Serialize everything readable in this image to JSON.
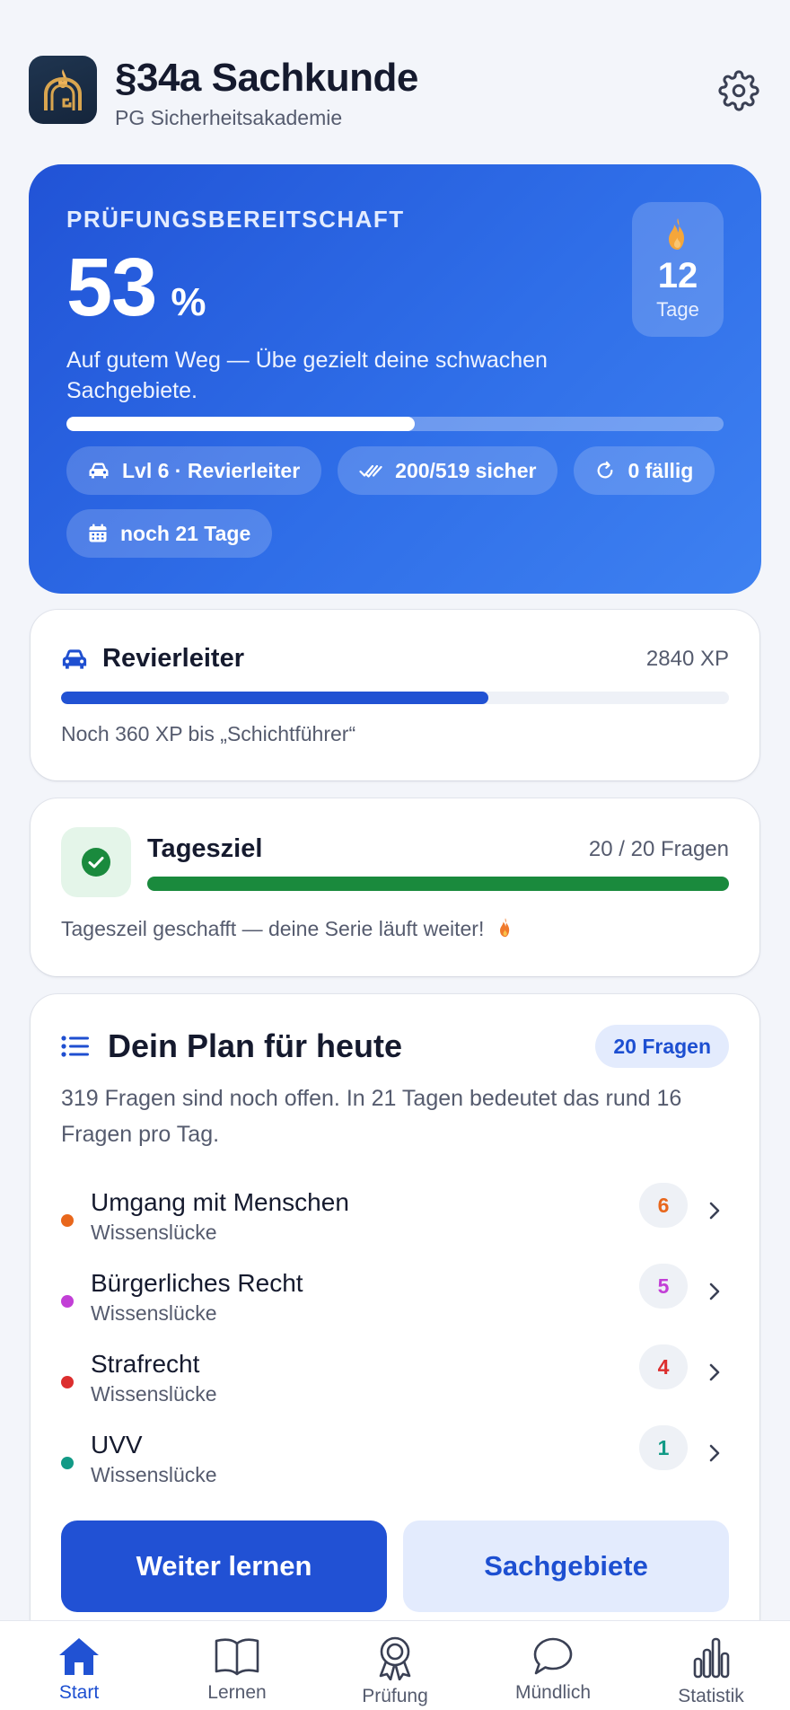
{
  "header": {
    "title": "§34a Sachkunde",
    "subtitle": "PG Sicherheitsakademie",
    "logo_icon": "shield-flame-logo",
    "settings_icon": "gear-icon"
  },
  "readiness": {
    "label": "PRÜFUNGSBEREITSCHAFT",
    "value": "53",
    "unit": "%",
    "progress_fraction": 0.53,
    "message": "Auf gutem Weg — Übe gezielt deine schwachen Sachgebiete.",
    "streak": {
      "value": "12",
      "label": "Tage",
      "icon": "flame-icon"
    },
    "chips": [
      {
        "icon": "car-icon",
        "label": "Lvl 6 · Revierleiter"
      },
      {
        "icon": "double-check-icon",
        "label": "200/519 sicher"
      },
      {
        "icon": "refresh-icon",
        "label": "0 fällig"
      },
      {
        "icon": "calendar-icon",
        "label": "noch 21 Tage"
      }
    ]
  },
  "level": {
    "name": "Revierleiter",
    "xp": "2840 XP",
    "progress_fraction": 0.64,
    "note": "Noch 360 XP bis „Schichtführer“"
  },
  "daily_goal": {
    "title": "Tagesziel",
    "count": "20 / 20 Fragen",
    "progress_fraction": 1.0,
    "note": "Tageszeil geschafft — deine Serie läuft weiter!"
  },
  "plan": {
    "title": "Dein Plan für heute",
    "badge": "20 Fragen",
    "description": "319 Fragen sind noch offen. In 21 Tagen bedeutet das rund 16 Fragen pro Tag.",
    "items": [
      {
        "name": "Umgang mit Menschen",
        "sub": "Wissenslücke",
        "count": "6",
        "color": "#e8671c"
      },
      {
        "name": "Bürgerliches Recht",
        "sub": "Wissenslücke",
        "count": "5",
        "color": "#c23fd6"
      },
      {
        "name": "Strafrecht",
        "sub": "Wissenslücke",
        "count": "4",
        "color": "#dc2e2e"
      },
      {
        "name": "UVV",
        "sub": "Wissenslücke",
        "count": "1",
        "color": "#129a86"
      }
    ],
    "primary_button": "Weiter lernen",
    "secondary_button": "Sachgebiete"
  },
  "nav": {
    "items": [
      {
        "label": "Start",
        "icon": "home-icon",
        "active": true
      },
      {
        "label": "Lernen",
        "icon": "book-icon",
        "active": false
      },
      {
        "label": "Prüfung",
        "icon": "award-icon",
        "active": false
      },
      {
        "label": "Mündlich",
        "icon": "chat-bubble-icon",
        "active": false
      },
      {
        "label": "Statistik",
        "icon": "bar-chart-icon",
        "active": false
      }
    ]
  },
  "colors": {
    "accent": "#2151d4",
    "success": "#1a8a3d",
    "streak_flame": "#f5a63a"
  }
}
